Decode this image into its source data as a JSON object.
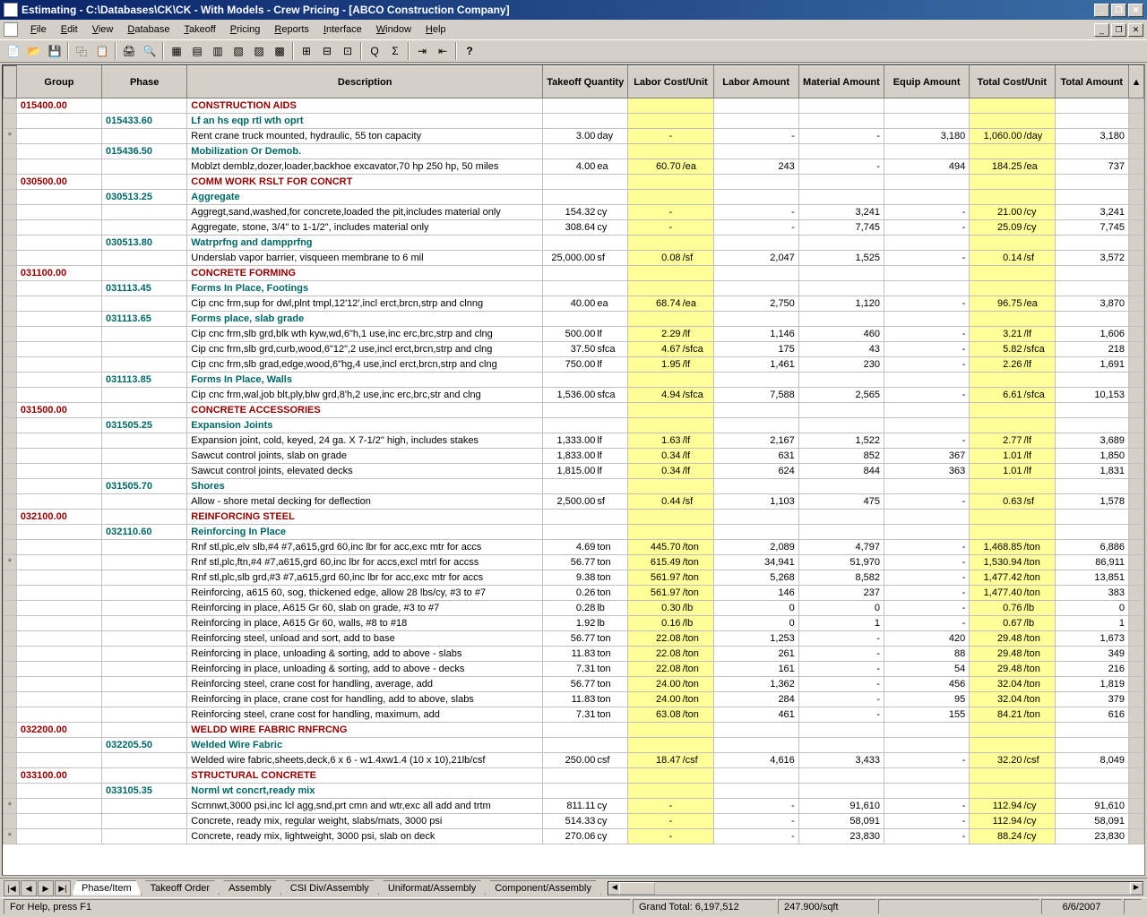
{
  "title": "Estimating - C:\\Databases\\CK\\CK - With Models - Crew Pricing - [ABCO Construction Company]",
  "menus": [
    "File",
    "Edit",
    "View",
    "Database",
    "Takeoff",
    "Pricing",
    "Reports",
    "Interface",
    "Window",
    "Help"
  ],
  "headers": {
    "group": "Group",
    "phase": "Phase",
    "desc": "Description",
    "qty": "Takeoff Quantity",
    "lcu": "Labor Cost/Unit",
    "lamt": "Labor Amount",
    "mamt": "Material Amount",
    "eamt": "Equip Amount",
    "tcu": "Total Cost/Unit",
    "tamt": "Total Amount"
  },
  "tabs": [
    "Phase/Item",
    "Takeoff Order",
    "Assembly",
    "CSI Div/Assembly",
    "Uniformat/Assembly",
    "Component/Assembly"
  ],
  "status": {
    "help": "For Help, press F1",
    "grand": "Grand Total: 6,197,512",
    "sqft": "247.900/sqft",
    "date": "6/6/2007"
  },
  "rows": [
    {
      "t": "g",
      "group": "015400.00",
      "desc": "CONSTRUCTION AIDS"
    },
    {
      "t": "p",
      "phase": "015433.60",
      "desc": "Lf an hs eqp rtl wth oprt"
    },
    {
      "t": "i",
      "mark": "*",
      "desc": "Rent crane truck mounted, hydraulic, 55 ton capacity",
      "qty": "3.00",
      "un": "day",
      "lcu": "-",
      "lamt": "-",
      "mamt": "-",
      "eamt": "3,180",
      "tcu": "1,060.00",
      "tun": "/day",
      "tamt": "3,180"
    },
    {
      "t": "p",
      "phase": "015436.50",
      "desc": "Mobilization Or Demob."
    },
    {
      "t": "i",
      "desc": "Moblzt demblz,dozer,loader,backhoe excavator,70 hp 250 hp, 50 miles",
      "qty": "4.00",
      "un": "ea",
      "lcu": "60.70",
      "lun": "/ea",
      "lamt": "243",
      "mamt": "-",
      "eamt": "494",
      "tcu": "184.25",
      "tun": "/ea",
      "tamt": "737"
    },
    {
      "t": "g",
      "group": "030500.00",
      "desc": "COMM WORK RSLT FOR CONCRT"
    },
    {
      "t": "p",
      "phase": "030513.25",
      "desc": "Aggregate"
    },
    {
      "t": "i",
      "desc": "Aggregt,sand,washed,for concrete,loaded the pit,includes material only",
      "qty": "154.32",
      "un": "cy",
      "lcu": "-",
      "lamt": "-",
      "mamt": "3,241",
      "eamt": "-",
      "tcu": "21.00",
      "tun": "/cy",
      "tamt": "3,241"
    },
    {
      "t": "i",
      "desc": "Aggregate, stone, 3/4\" to 1-1/2\", includes material only",
      "qty": "308.64",
      "un": "cy",
      "lcu": "-",
      "lamt": "-",
      "mamt": "7,745",
      "eamt": "-",
      "tcu": "25.09",
      "tun": "/cy",
      "tamt": "7,745"
    },
    {
      "t": "p",
      "phase": "030513.80",
      "desc": "Watrprfng and dampprfng"
    },
    {
      "t": "i",
      "desc": "Underslab vapor barrier, visqueen membrane to 6 mil",
      "qty": "25,000.00",
      "un": "sf",
      "lcu": "0.08",
      "lun": "/sf",
      "lamt": "2,047",
      "mamt": "1,525",
      "eamt": "-",
      "tcu": "0.14",
      "tun": "/sf",
      "tamt": "3,572"
    },
    {
      "t": "g",
      "group": "031100.00",
      "desc": "CONCRETE FORMING"
    },
    {
      "t": "p",
      "phase": "031113.45",
      "desc": "Forms In Place, Footings"
    },
    {
      "t": "i",
      "desc": "Cip cnc frm,sup for dwl,plnt tmpl,12'12',incl erct,brcn,strp and clnng",
      "qty": "40.00",
      "un": "ea",
      "lcu": "68.74",
      "lun": "/ea",
      "lamt": "2,750",
      "mamt": "1,120",
      "eamt": "-",
      "tcu": "96.75",
      "tun": "/ea",
      "tamt": "3,870"
    },
    {
      "t": "p",
      "phase": "031113.65",
      "desc": "Forms place, slab grade"
    },
    {
      "t": "i",
      "desc": "Cip cnc frm,slb grd,blk wth kyw,wd,6\"h,1 use,inc erc,brc,strp and clng",
      "qty": "500.00",
      "un": "lf",
      "lcu": "2.29",
      "lun": "/lf",
      "lamt": "1,146",
      "mamt": "460",
      "eamt": "-",
      "tcu": "3.21",
      "tun": "/lf",
      "tamt": "1,606"
    },
    {
      "t": "i",
      "desc": "Cip cnc frm,slb grd,curb,wood,6\"12\",2 use,incl erct,brcn,strp and clng",
      "qty": "37.50",
      "un": "sfca",
      "lcu": "4.67",
      "lun": "/sfca",
      "lamt": "175",
      "mamt": "43",
      "eamt": "-",
      "tcu": "5.82",
      "tun": "/sfca",
      "tamt": "218"
    },
    {
      "t": "i",
      "desc": "Cip cnc frm,slb grad,edge,wood,6\"hg,4 use,incl erct,brcn,strp and clng",
      "qty": "750.00",
      "un": "lf",
      "lcu": "1.95",
      "lun": "/lf",
      "lamt": "1,461",
      "mamt": "230",
      "eamt": "-",
      "tcu": "2.26",
      "tun": "/lf",
      "tamt": "1,691"
    },
    {
      "t": "p",
      "phase": "031113.85",
      "desc": "Forms In Place, Walls"
    },
    {
      "t": "i",
      "desc": "Cip cnc frm,wal,job blt,ply,blw grd,8'h,2 use,inc erc,brc,str and clng",
      "qty": "1,536.00",
      "un": "sfca",
      "lcu": "4.94",
      "lun": "/sfca",
      "lamt": "7,588",
      "mamt": "2,565",
      "eamt": "-",
      "tcu": "6.61",
      "tun": "/sfca",
      "tamt": "10,153"
    },
    {
      "t": "g",
      "group": "031500.00",
      "desc": "CONCRETE ACCESSORIES"
    },
    {
      "t": "p",
      "phase": "031505.25",
      "desc": "Expansion Joints"
    },
    {
      "t": "i",
      "desc": "Expansion joint, cold, keyed, 24 ga. X 7-1/2\" high, includes stakes",
      "qty": "1,333.00",
      "un": "lf",
      "lcu": "1.63",
      "lun": "/lf",
      "lamt": "2,167",
      "mamt": "1,522",
      "eamt": "-",
      "tcu": "2.77",
      "tun": "/lf",
      "tamt": "3,689"
    },
    {
      "t": "i",
      "desc": "Sawcut control joints, slab on grade",
      "qty": "1,833.00",
      "un": "lf",
      "lcu": "0.34",
      "lun": "/lf",
      "lamt": "631",
      "mamt": "852",
      "eamt": "367",
      "tcu": "1.01",
      "tun": "/lf",
      "tamt": "1,850"
    },
    {
      "t": "i",
      "desc": "Sawcut control joints, elevated decks",
      "qty": "1,815.00",
      "un": "lf",
      "lcu": "0.34",
      "lun": "/lf",
      "lamt": "624",
      "mamt": "844",
      "eamt": "363",
      "tcu": "1.01",
      "tun": "/lf",
      "tamt": "1,831"
    },
    {
      "t": "p",
      "phase": "031505.70",
      "desc": "Shores"
    },
    {
      "t": "i",
      "desc": "Allow - shore metal decking for deflection",
      "qty": "2,500.00",
      "un": "sf",
      "lcu": "0.44",
      "lun": "/sf",
      "lamt": "1,103",
      "mamt": "475",
      "eamt": "-",
      "tcu": "0.63",
      "tun": "/sf",
      "tamt": "1,578"
    },
    {
      "t": "g",
      "group": "032100.00",
      "desc": "REINFORCING STEEL"
    },
    {
      "t": "p",
      "phase": "032110.60",
      "desc": "Reinforcing In Place"
    },
    {
      "t": "i",
      "desc": "Rnf stl,plc,elv slb,#4 #7,a615,grd 60,inc lbr for acc,exc mtr for accs",
      "qty": "4.69",
      "un": "ton",
      "lcu": "445.70",
      "lun": "/ton",
      "lamt": "2,089",
      "mamt": "4,797",
      "eamt": "-",
      "tcu": "1,468.85",
      "tun": "/ton",
      "tamt": "6,886"
    },
    {
      "t": "i",
      "mark": "*",
      "desc": "Rnf stl,plc,ftn,#4 #7,a615,grd 60,inc lbr for accs,excl mtrl for accss",
      "qty": "56.77",
      "un": "ton",
      "lcu": "615.49",
      "lun": "/ton",
      "lamt": "34,941",
      "mamt": "51,970",
      "eamt": "-",
      "tcu": "1,530.94",
      "tun": "/ton",
      "tamt": "86,911"
    },
    {
      "t": "i",
      "desc": "Rnf stl,plc,slb grd,#3 #7,a615,grd 60,inc lbr for acc,exc mtr for accs",
      "qty": "9.38",
      "un": "ton",
      "lcu": "561.97",
      "lun": "/ton",
      "lamt": "5,268",
      "mamt": "8,582",
      "eamt": "-",
      "tcu": "1,477.42",
      "tun": "/ton",
      "tamt": "13,851"
    },
    {
      "t": "i",
      "desc": "Reinforcing, a615 60, sog, thickened edge, allow 28 lbs/cy, #3 to #7",
      "qty": "0.26",
      "un": "ton",
      "lcu": "561.97",
      "lun": "/ton",
      "lamt": "146",
      "mamt": "237",
      "eamt": "-",
      "tcu": "1,477.40",
      "tun": "/ton",
      "tamt": "383"
    },
    {
      "t": "i",
      "desc": "Reinforcing in place, A615 Gr 60, slab on grade, #3 to #7",
      "qty": "0.28",
      "un": "lb",
      "lcu": "0.30",
      "lun": "/lb",
      "lamt": "0",
      "mamt": "0",
      "eamt": "-",
      "tcu": "0.76",
      "tun": "/lb",
      "tamt": "0"
    },
    {
      "t": "i",
      "desc": "Reinforcing in place, A615 Gr 60, walls, #8 to #18",
      "qty": "1.92",
      "un": "lb",
      "lcu": "0.16",
      "lun": "/lb",
      "lamt": "0",
      "mamt": "1",
      "eamt": "-",
      "tcu": "0.67",
      "tun": "/lb",
      "tamt": "1"
    },
    {
      "t": "i",
      "desc": "Reinforcing steel, unload and sort, add to base",
      "qty": "56.77",
      "un": "ton",
      "lcu": "22.08",
      "lun": "/ton",
      "lamt": "1,253",
      "mamt": "-",
      "eamt": "420",
      "tcu": "29.48",
      "tun": "/ton",
      "tamt": "1,673"
    },
    {
      "t": "i",
      "desc": "Reinforcing in place, unloading & sorting, add to above - slabs",
      "qty": "11.83",
      "un": "ton",
      "lcu": "22.08",
      "lun": "/ton",
      "lamt": "261",
      "mamt": "-",
      "eamt": "88",
      "tcu": "29.48",
      "tun": "/ton",
      "tamt": "349"
    },
    {
      "t": "i",
      "desc": "Reinforcing in place, unloading & sorting, add to above - decks",
      "qty": "7.31",
      "un": "ton",
      "lcu": "22.08",
      "lun": "/ton",
      "lamt": "161",
      "mamt": "-",
      "eamt": "54",
      "tcu": "29.48",
      "tun": "/ton",
      "tamt": "216"
    },
    {
      "t": "i",
      "desc": "Reinforcing steel, crane cost for handling, average, add",
      "qty": "56.77",
      "un": "ton",
      "lcu": "24.00",
      "lun": "/ton",
      "lamt": "1,362",
      "mamt": "-",
      "eamt": "456",
      "tcu": "32.04",
      "tun": "/ton",
      "tamt": "1,819"
    },
    {
      "t": "i",
      "desc": "Reinforcing in place, crane cost for handling, add to above, slabs",
      "qty": "11.83",
      "un": "ton",
      "lcu": "24.00",
      "lun": "/ton",
      "lamt": "284",
      "mamt": "-",
      "eamt": "95",
      "tcu": "32.04",
      "tun": "/ton",
      "tamt": "379"
    },
    {
      "t": "i",
      "desc": "Reinforcing steel, crane cost for handling, maximum, add",
      "qty": "7.31",
      "un": "ton",
      "lcu": "63.08",
      "lun": "/ton",
      "lamt": "461",
      "mamt": "-",
      "eamt": "155",
      "tcu": "84.21",
      "tun": "/ton",
      "tamt": "616"
    },
    {
      "t": "g",
      "group": "032200.00",
      "desc": "WELDD WIRE FABRIC RNFRCNG"
    },
    {
      "t": "p",
      "phase": "032205.50",
      "desc": "Welded Wire Fabric"
    },
    {
      "t": "i",
      "desc": "Welded wire fabric,sheets,deck,6 x 6 - w1.4xw1.4 (10 x 10),21lb/csf",
      "qty": "250.00",
      "un": "csf",
      "lcu": "18.47",
      "lun": "/csf",
      "lamt": "4,616",
      "mamt": "3,433",
      "eamt": "-",
      "tcu": "32.20",
      "tun": "/csf",
      "tamt": "8,049"
    },
    {
      "t": "g",
      "group": "033100.00",
      "desc": "STRUCTURAL CONCRETE"
    },
    {
      "t": "p",
      "phase": "033105.35",
      "desc": "Norml wt concrt,ready mix"
    },
    {
      "t": "i",
      "mark": "*",
      "desc": "Scrnnwt,3000 psi,inc lcl agg,snd,prt cmn and wtr,exc all add and trtm",
      "qty": "811.11",
      "un": "cy",
      "lcu": "-",
      "lamt": "-",
      "mamt": "91,610",
      "eamt": "-",
      "tcu": "112.94",
      "tun": "/cy",
      "tamt": "91,610"
    },
    {
      "t": "i",
      "desc": "Concrete, ready mix, regular weight, slabs/mats, 3000 psi",
      "qty": "514.33",
      "un": "cy",
      "lcu": "-",
      "lamt": "-",
      "mamt": "58,091",
      "eamt": "-",
      "tcu": "112.94",
      "tun": "/cy",
      "tamt": "58,091"
    },
    {
      "t": "i",
      "mark": "*",
      "desc": "Concrete, ready mix, lightweight, 3000 psi, slab on deck",
      "qty": "270.06",
      "un": "cy",
      "lcu": "-",
      "lamt": "-",
      "mamt": "23,830",
      "eamt": "-",
      "tcu": "88.24",
      "tun": "/cy",
      "tamt": "23,830"
    }
  ]
}
